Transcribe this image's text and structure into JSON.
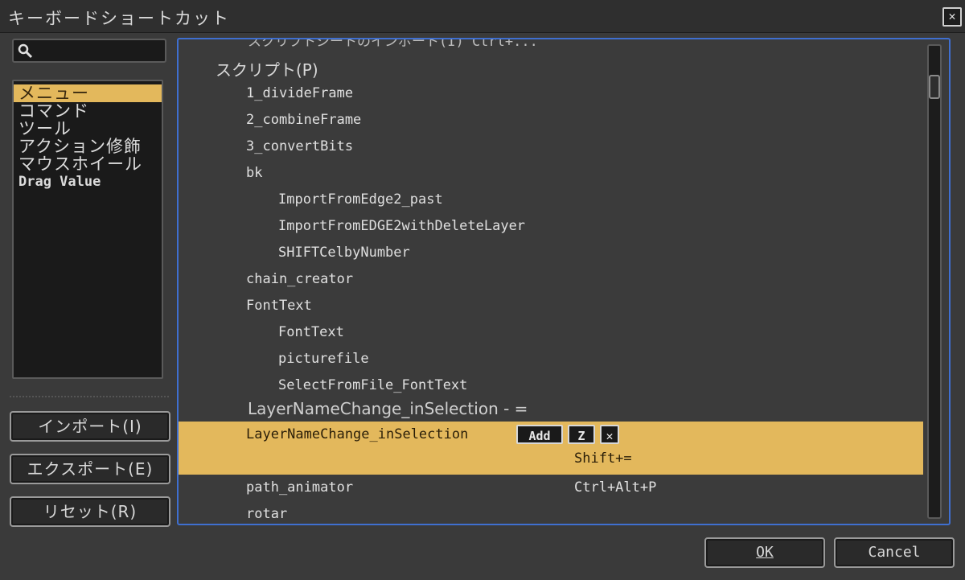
{
  "window": {
    "title": "キーボードショートカット",
    "close_glyph": "✕"
  },
  "search": {
    "value": "",
    "placeholder": ""
  },
  "categories": [
    {
      "label": "メニュー",
      "selected": true
    },
    {
      "label": "コマンド",
      "selected": false
    },
    {
      "label": "ツール",
      "selected": false
    },
    {
      "label": "アクション修飾",
      "selected": false
    },
    {
      "label": "マウスホイール",
      "selected": false
    },
    {
      "label": "Drag Value",
      "selected": false
    }
  ],
  "side_buttons": {
    "import": "インポート(I)",
    "export": "エクスポート(E)",
    "reset": "リセット(R)"
  },
  "list": {
    "cut_top": "スクリプトシートのインポート(I)    Ctrl+...",
    "rows": [
      {
        "label": "スクリプト(P)",
        "shortcut": ""
      },
      {
        "label": "1_divideFrame",
        "shortcut": ""
      },
      {
        "label": "2_combineFrame",
        "shortcut": ""
      },
      {
        "label": "3_convertBits",
        "shortcut": ""
      },
      {
        "label": "bk",
        "shortcut": ""
      },
      {
        "label": "ImportFromEdge2_past",
        "shortcut": ""
      },
      {
        "label": "ImportFromEDGE2withDeleteLayer",
        "shortcut": ""
      },
      {
        "label": "SHIFTCelbyNumber",
        "shortcut": ""
      },
      {
        "label": "chain_creator",
        "shortcut": ""
      },
      {
        "label": "FontText",
        "shortcut": ""
      },
      {
        "label": "FontText",
        "shortcut": ""
      },
      {
        "label": "picturefile",
        "shortcut": ""
      },
      {
        "label": "SelectFromFile_FontText",
        "shortcut": ""
      },
      {
        "label": "LayerNameChange_inSelection - =",
        "shortcut": ""
      },
      {
        "label": "LayerNameChange_inSelection",
        "shortcut": "Shift+="
      },
      {
        "label": "path_animator",
        "shortcut": "Ctrl+Alt+P"
      },
      {
        "label": "rotar",
        "shortcut": ""
      }
    ],
    "edit_buttons": {
      "add": "Add",
      "key": "Z",
      "remove": "✕"
    }
  },
  "footer": {
    "ok": "OK",
    "cancel": "Cancel"
  },
  "colors": {
    "accent_selected": "#e3b85c",
    "focus_border": "#3f6fd0",
    "background": "#3a3a3a"
  }
}
